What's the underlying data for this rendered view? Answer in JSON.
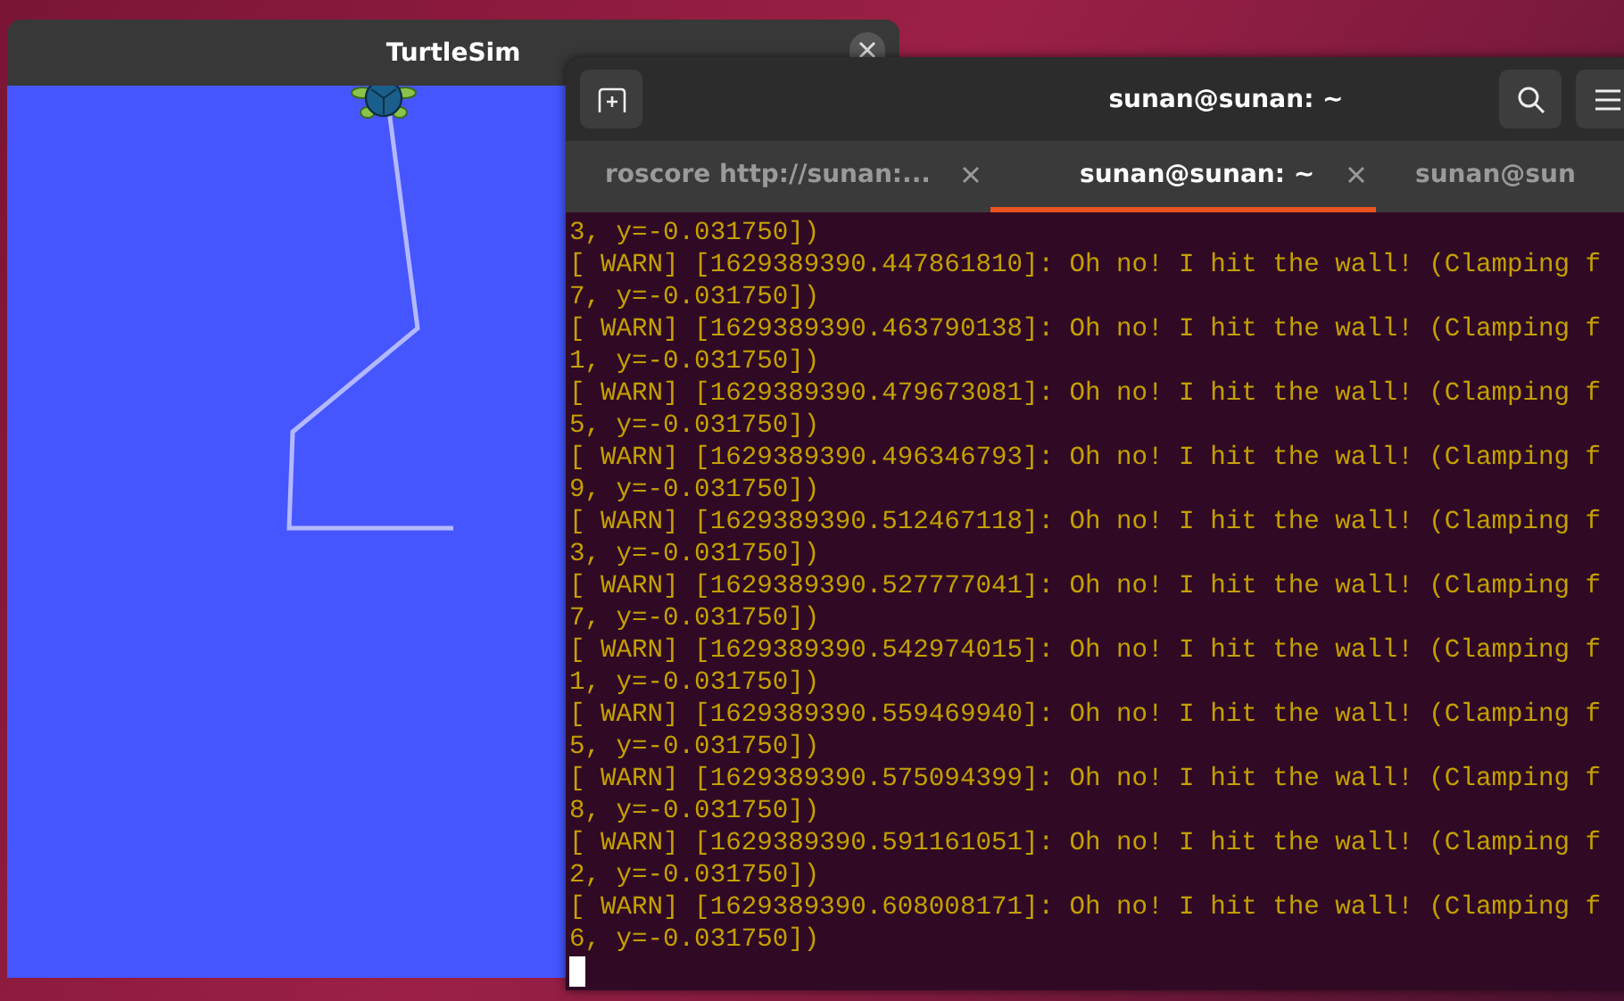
{
  "turtlesim": {
    "title": "TurtleSim"
  },
  "terminal": {
    "title": "sunan@sunan: ~",
    "tabs": [
      {
        "label": "roscore http://sunan:...",
        "selected": false,
        "closable": true
      },
      {
        "label": "sunan@sunan: ~",
        "selected": true,
        "closable": true
      },
      {
        "label": "sunan@sun",
        "selected": false,
        "closable": false
      }
    ],
    "lines": [
      "3, y=-0.031750])",
      "[ WARN] [1629389390.447861810]: Oh no! I hit the wall! (Clamping f",
      "7, y=-0.031750])",
      "[ WARN] [1629389390.463790138]: Oh no! I hit the wall! (Clamping f",
      "1, y=-0.031750])",
      "[ WARN] [1629389390.479673081]: Oh no! I hit the wall! (Clamping f",
      "5, y=-0.031750])",
      "[ WARN] [1629389390.496346793]: Oh no! I hit the wall! (Clamping f",
      "9, y=-0.031750])",
      "[ WARN] [1629389390.512467118]: Oh no! I hit the wall! (Clamping f",
      "3, y=-0.031750])",
      "[ WARN] [1629389390.527777041]: Oh no! I hit the wall! (Clamping f",
      "7, y=-0.031750])",
      "[ WARN] [1629389390.542974015]: Oh no! I hit the wall! (Clamping f",
      "1, y=-0.031750])",
      "[ WARN] [1629389390.559469940]: Oh no! I hit the wall! (Clamping f",
      "5, y=-0.031750])",
      "[ WARN] [1629389390.575094399]: Oh no! I hit the wall! (Clamping f",
      "8, y=-0.031750])",
      "[ WARN] [1629389390.591161051]: Oh no! I hit the wall! (Clamping f",
      "2, y=-0.031750])",
      "[ WARN] [1629389390.608008171]: Oh no! I hit the wall! (Clamping f",
      "6, y=-0.031750])"
    ]
  }
}
